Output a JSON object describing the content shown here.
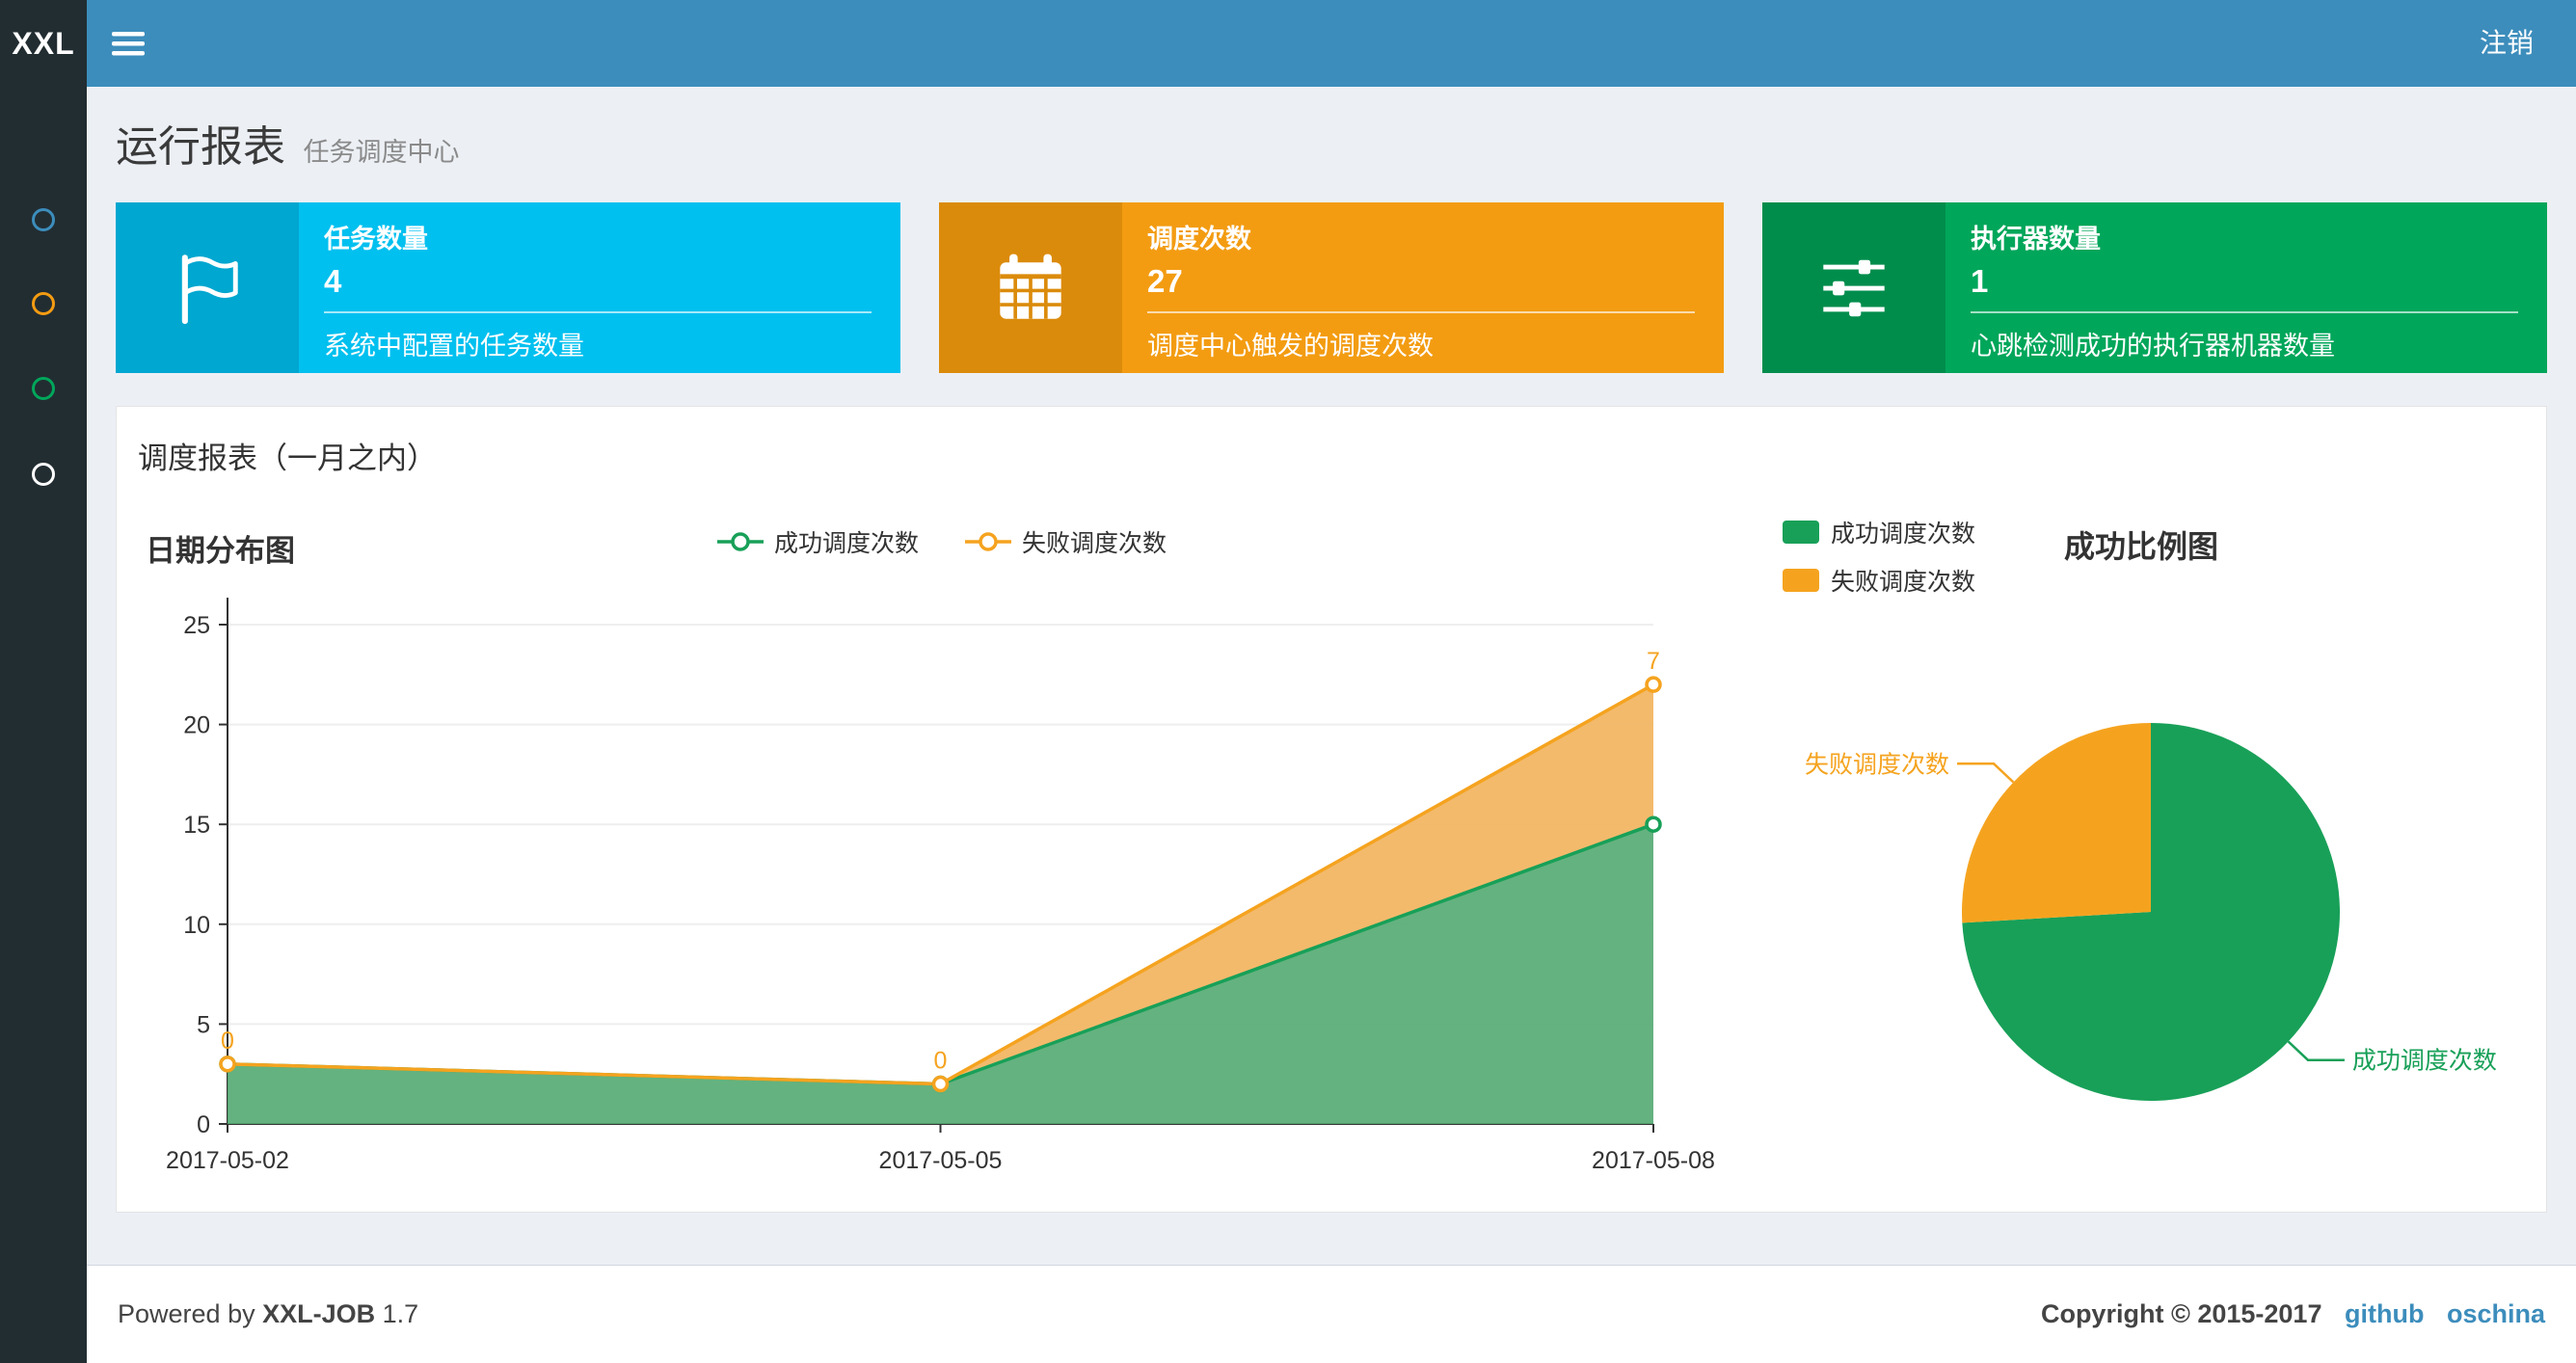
{
  "navbar": {
    "logo": "XXL",
    "logout": "注销"
  },
  "sidebar": {
    "items": [
      {
        "name": "menu-1",
        "color": "#3c8dbc"
      },
      {
        "name": "menu-2",
        "color": "#f39c12"
      },
      {
        "name": "menu-3",
        "color": "#00a65a"
      },
      {
        "name": "menu-4",
        "color": "#ffffff"
      }
    ]
  },
  "header": {
    "title": "运行报表",
    "subtitle": "任务调度中心"
  },
  "info_boxes": [
    {
      "icon": "flag-icon",
      "title": "任务数量",
      "value": "4",
      "desc": "系统中配置的任务数量",
      "bg": "#00c0ef",
      "icon_bg": "#00a7d0"
    },
    {
      "icon": "calendar-icon",
      "title": "调度次数",
      "value": "27",
      "desc": "调度中心触发的调度次数",
      "bg": "#f39c12",
      "icon_bg": "#db8b0b"
    },
    {
      "icon": "sliders-icon",
      "title": "执行器数量",
      "value": "1",
      "desc": "心跳检测成功的执行器机器数量",
      "bg": "#00a65a",
      "icon_bg": "#008d4c"
    }
  ],
  "panel": {
    "title": "调度报表（一月之内）"
  },
  "chart_data": [
    {
      "type": "area",
      "title": "日期分布图",
      "stacked": true,
      "x": [
        "2017-05-02",
        "2017-05-05",
        "2017-05-08"
      ],
      "series": [
        {
          "name": "成功调度次数",
          "color": "#18a058",
          "area_color": "#57ab74",
          "values": [
            3,
            2,
            15
          ]
        },
        {
          "name": "失败调度次数",
          "color": "#f5a31f",
          "area_color": "#f2b45f",
          "values": [
            0,
            0,
            7
          ],
          "point_labels": [
            "0",
            "0",
            "7"
          ]
        }
      ],
      "ylim": [
        0,
        25
      ],
      "yticks": [
        0,
        5,
        10,
        15,
        20,
        25
      ],
      "legend_position": "top-center",
      "grid": true
    },
    {
      "type": "pie",
      "title": "成功比例图",
      "slices": [
        {
          "name": "成功调度次数",
          "value": 20,
          "color": "#18a058"
        },
        {
          "name": "失败调度次数",
          "value": 7,
          "color": "#f5a31f"
        }
      ],
      "legend_position": "top-left"
    }
  ],
  "footer": {
    "powered": "Powered by",
    "product": "XXL-JOB",
    "version": "1.7",
    "copyright": "Copyright © 2015-2017",
    "links": [
      {
        "label": "github"
      },
      {
        "label": "oschina"
      }
    ]
  }
}
